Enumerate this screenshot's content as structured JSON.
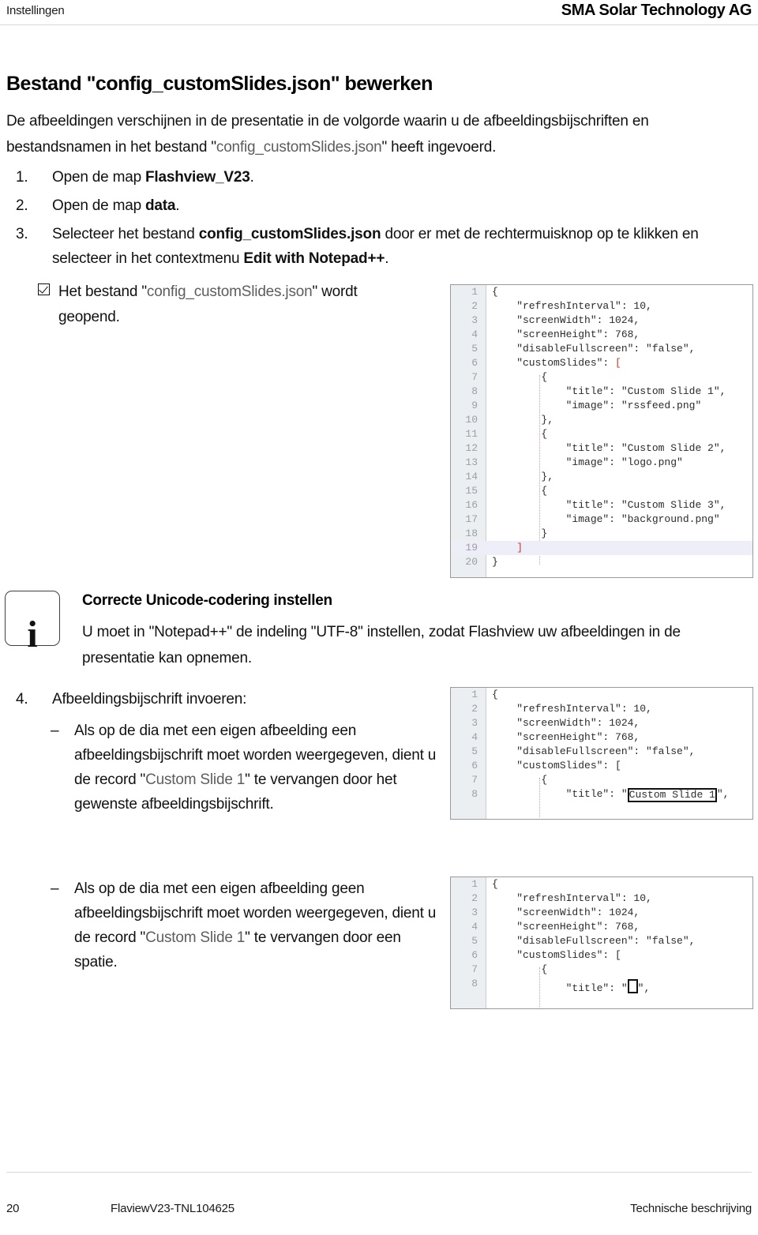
{
  "header": {
    "left": "Instellingen",
    "right": "SMA Solar Technology AG"
  },
  "title": "Bestand \"config_customSlides.json\" bewerken",
  "intro": {
    "part1": "De afbeeldingen verschijnen in de presentatie in de volgorde waarin u de afbeeldingsbijschriften en bestandsnamen in het bestand \"",
    "filename": "config_customSlides.json",
    "part2": "\" heeft ingevoerd."
  },
  "steps": [
    {
      "num": "1.",
      "pre": "Open de map ",
      "bold": "Flashview_V23",
      "post": "."
    },
    {
      "num": "2.",
      "pre": "Open de map ",
      "bold": "data",
      "post": "."
    },
    {
      "num": "3.",
      "pre": "Selecteer het bestand ",
      "bold": "config_customSlides.json",
      "mid": " door er met de rechtermuisknop op te klikken en selecteer in het contextmenu ",
      "bold2": "Edit with Notepad++",
      "post": "."
    },
    {
      "num": "4.",
      "pre": "Afbeeldingsbijschrift invoeren:",
      "bold": "",
      "post": ""
    }
  ],
  "result": {
    "pre": "Het bestand \"",
    "filename": "config_customSlides.json",
    "post": "\" wordt geopend."
  },
  "note": {
    "icon": "info-icon",
    "glyph": "i",
    "title": "Correcte Unicode-codering instellen",
    "text": "U moet in \"Notepad++\" de indeling \"UTF-8\" instellen, zodat Flashview uw afbeeldingen in de presentatie kan opnemen."
  },
  "subbullets": [
    {
      "dash": "–",
      "pre": "Als op de dia met een eigen afbeelding een afbeeldingsbijschrift moet worden weergegeven, dient u de record \"",
      "code": "Custom Slide 1",
      "post": "\" te vervangen door het gewenste afbeeldingsbijschrift."
    },
    {
      "dash": "–",
      "pre": "Als op de dia met een eigen afbeelding geen afbeeldingsbijschrift moet worden weergegeven, dient u de record \"",
      "code": "Custom Slide 1",
      "post": "\" te vervangen door een spatie."
    }
  ],
  "code_blocks": [
    {
      "name": "full-config-json",
      "highlight_line": 19,
      "lines": [
        {
          "no": "1",
          "text": "{"
        },
        {
          "no": "2",
          "text": "    \"refreshInterval\": 10,"
        },
        {
          "no": "3",
          "text": "    \"screenWidth\": 1024,"
        },
        {
          "no": "4",
          "text": "    \"screenHeight\": 768,"
        },
        {
          "no": "5",
          "text": "    \"disableFullscreen\": \"false\","
        },
        {
          "no": "6",
          "text": "    \"customSlides\": [",
          "bracket_at_end": true
        },
        {
          "no": "7",
          "text": "        {"
        },
        {
          "no": "8",
          "text": "            \"title\": \"Custom Slide 1\","
        },
        {
          "no": "9",
          "text": "            \"image\": \"rssfeed.png\""
        },
        {
          "no": "10",
          "text": "        },"
        },
        {
          "no": "11",
          "text": "        {"
        },
        {
          "no": "12",
          "text": "            \"title\": \"Custom Slide 2\","
        },
        {
          "no": "13",
          "text": "            \"image\": \"logo.png\""
        },
        {
          "no": "14",
          "text": "        },"
        },
        {
          "no": "15",
          "text": "        {"
        },
        {
          "no": "16",
          "text": "            \"title\": \"Custom Slide 3\","
        },
        {
          "no": "17",
          "text": "            \"image\": \"background.png\""
        },
        {
          "no": "18",
          "text": "        }"
        },
        {
          "no": "19",
          "text": "    ]",
          "bracket_at_end": true
        },
        {
          "no": "20",
          "text": "}"
        }
      ]
    },
    {
      "name": "config-json-title-selected",
      "selection": "Custom Slide 1",
      "lines": [
        {
          "no": "1",
          "text": "{"
        },
        {
          "no": "2",
          "text": "    \"refreshInterval\": 10,"
        },
        {
          "no": "3",
          "text": "    \"screenWidth\": 1024,"
        },
        {
          "no": "4",
          "text": "    \"screenHeight\": 768,"
        },
        {
          "no": "5",
          "text": "    \"disableFullscreen\": \"false\","
        },
        {
          "no": "6",
          "text": "    \"customSlides\": ["
        },
        {
          "no": "7",
          "text": "        {"
        },
        {
          "no": "8",
          "text": "            \"title\": \"",
          "boxed": "Custom Slide 1",
          "after": "\","
        }
      ]
    },
    {
      "name": "config-json-title-blank",
      "selection": " ",
      "lines": [
        {
          "no": "1",
          "text": "{"
        },
        {
          "no": "2",
          "text": "    \"refreshInterval\": 10,"
        },
        {
          "no": "3",
          "text": "    \"screenWidth\": 1024,"
        },
        {
          "no": "4",
          "text": "    \"screenHeight\": 768,"
        },
        {
          "no": "5",
          "text": "    \"disableFullscreen\": \"false\","
        },
        {
          "no": "6",
          "text": "    \"customSlides\": ["
        },
        {
          "no": "7",
          "text": "        {"
        },
        {
          "no": "8",
          "text": "            \"title\": \"",
          "boxed": "",
          "after": "\","
        }
      ]
    }
  ],
  "footer": {
    "page": "20",
    "doc_id": "FlaviewV23-TNL104625",
    "right": "Technische beschrijving"
  },
  "colors": {
    "text": "#111111",
    "muted": "#5d5d5d",
    "gutter_bg": "#eceff1",
    "line_number": "#9aa0a6",
    "bracket_red": "#c0392b",
    "highlight_line": "#eeeef9",
    "rule": "#d8d8d8"
  }
}
